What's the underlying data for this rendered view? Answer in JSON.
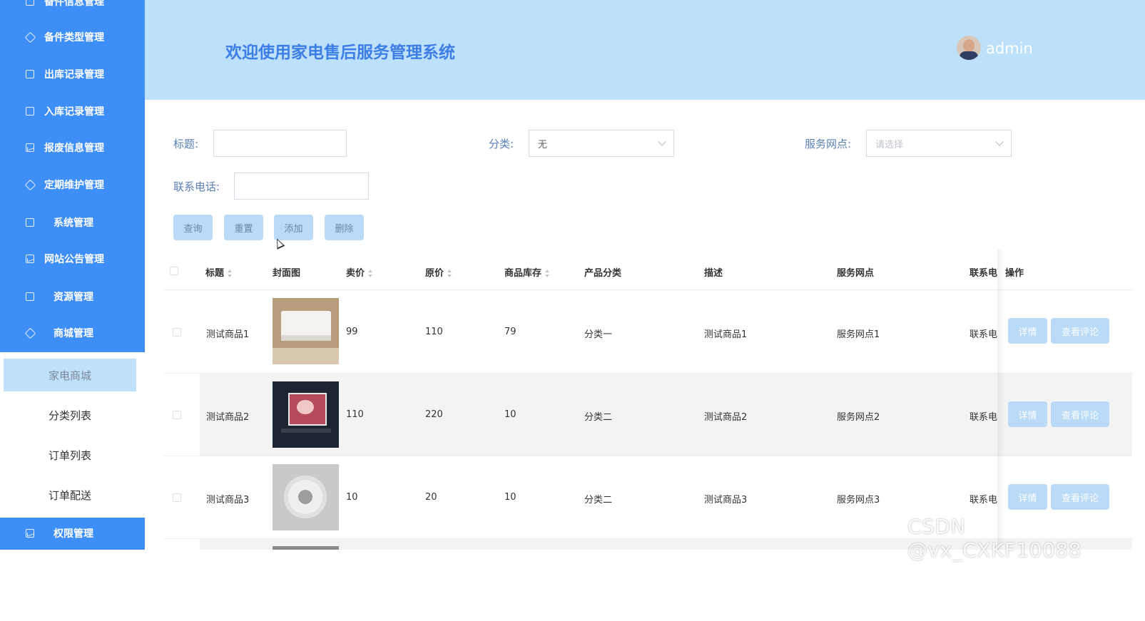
{
  "sidebar": {
    "menu": [
      {
        "label": "备件信息管理",
        "icon": "edit-icon"
      },
      {
        "label": "备件类型管理",
        "icon": "diamond-icon"
      },
      {
        "label": "出库记录管理",
        "icon": "edit-icon"
      },
      {
        "label": "入库记录管理",
        "icon": "yen-icon"
      },
      {
        "label": "报废信息管理",
        "icon": "chart-icon"
      },
      {
        "label": "定期维护管理",
        "icon": "diamond-icon"
      },
      {
        "label": "系统管理",
        "icon": "edit-icon"
      },
      {
        "label": "网站公告管理",
        "icon": "chart-icon"
      },
      {
        "label": "资源管理",
        "icon": "edit-icon"
      },
      {
        "label": "商城管理",
        "icon": "diamond-icon"
      }
    ],
    "submenu": [
      {
        "label": "家电商城"
      },
      {
        "label": "分类列表"
      },
      {
        "label": "订单列表"
      },
      {
        "label": "订单配送"
      }
    ],
    "bottom": {
      "label": "权限管理",
      "icon": "chart-icon"
    }
  },
  "header": {
    "title": "欢迎使用家电售后服务管理系统",
    "user": "admin"
  },
  "search": {
    "title_label": "标题:",
    "title_value": "",
    "category_label": "分类:",
    "category_value": "无",
    "outlet_label": "服务网点:",
    "outlet_placeholder": "请选择",
    "phone_label": "联系电话:",
    "phone_value": ""
  },
  "buttons": {
    "query": "查询",
    "reset": "重置",
    "add": "添加",
    "delete": "删除"
  },
  "table": {
    "columns": [
      "标题",
      "封面图",
      "卖价",
      "原价",
      "商品库存",
      "产品分类",
      "描述",
      "服务网点",
      "联系电",
      "操作"
    ],
    "rows": [
      {
        "title": "测试商品1",
        "image": "air-conditioner",
        "price": "99",
        "original": "110",
        "stock": "79",
        "category": "分类一",
        "desc": "测试商品1",
        "outlet": "服务网点1",
        "phone": "联系电"
      },
      {
        "title": "测试商品2",
        "image": "television",
        "price": "110",
        "original": "220",
        "stock": "10",
        "category": "分类二",
        "desc": "测试商品2",
        "outlet": "服务网点2",
        "phone": "联系电"
      },
      {
        "title": "测试商品3",
        "image": "ceiling-fan",
        "price": "10",
        "original": "20",
        "stock": "10",
        "category": "分类二",
        "desc": "测试商品3",
        "outlet": "服务网点3",
        "phone": "联系电"
      }
    ],
    "detail_label": "详情",
    "comments_label": "查看评论"
  },
  "watermark": "CSDN @vx_CXKF10088"
}
